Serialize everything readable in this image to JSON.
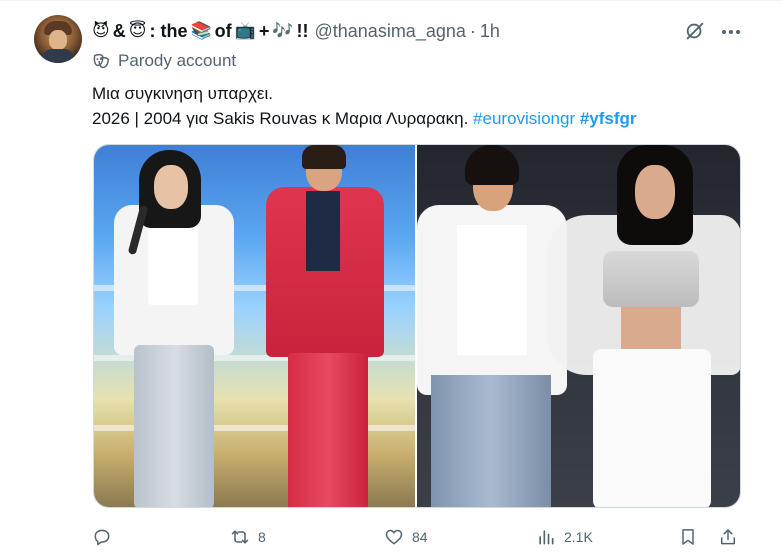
{
  "author": {
    "name_emoji_1": "😈",
    "name_part_1": "&",
    "name_emoji_2": "😇",
    "name_part_2": ": the",
    "name_emoji_3": "📚",
    "name_part_3": "of",
    "name_emoji_4": "📺",
    "name_part_4": "+",
    "name_emoji_5": "🎶",
    "name_part_5": "!!",
    "handle": "@thanasima_agna",
    "time": "1h",
    "label": "Parody account"
  },
  "tweet": {
    "line1": "Μια συγκινηση υπαρχει.",
    "line2_text": "2026 | 2004 για Sakis Rouvas κ Μαρια Λυραρακη.",
    "hashtag1": "#eurovisiongr",
    "hashtag2": "#yfsfgr"
  },
  "actions": {
    "reply": "",
    "retweets": "8",
    "likes": "84",
    "views": "2.1K"
  },
  "colors": {
    "accent": "#1d9bf0",
    "text": "#0f1419",
    "secondary": "#536471"
  },
  "icons": {
    "reply": "reply-icon",
    "retweet": "retweet-icon",
    "like": "heart-icon",
    "views": "views-icon",
    "bookmark": "bookmark-icon",
    "share": "share-icon",
    "grok": "grok-icon",
    "more": "more-icon",
    "parody": "parody-mask-icon"
  }
}
